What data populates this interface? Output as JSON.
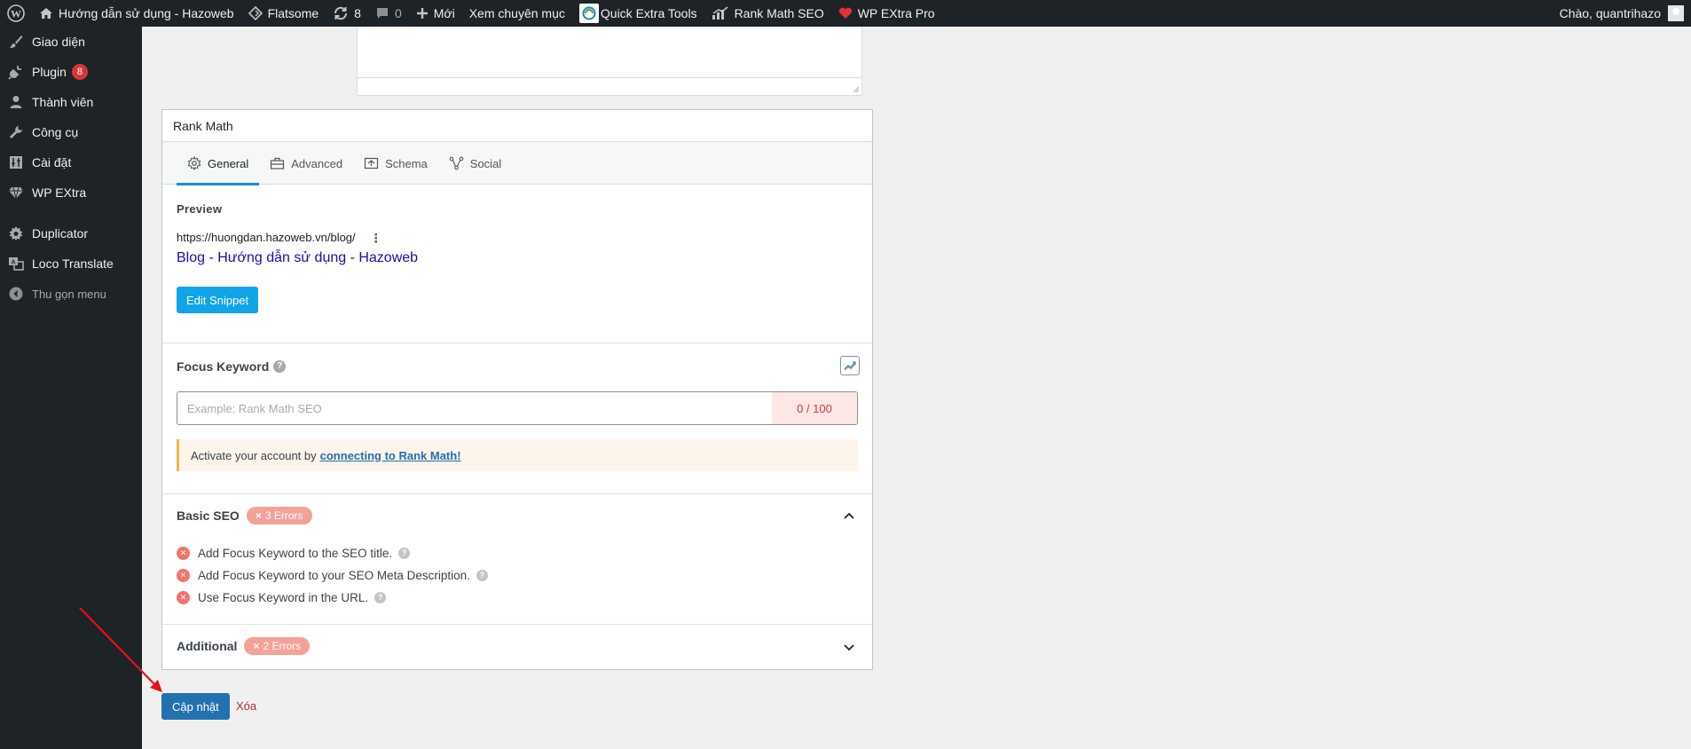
{
  "adminbar": {
    "site_name": "Hướng dẫn sử dụng - Hazoweb",
    "theme": "Flatsome",
    "updates_count": "8",
    "comments_count": "0",
    "new_label": "Mới",
    "view_category": "Xem chuyên mục",
    "quick_tools": "Quick Extra Tools",
    "rank_math": "Rank Math SEO",
    "wp_extra": "WP EXtra Pro",
    "greeting": "Chào, quantrihazo"
  },
  "sidebar": {
    "items": [
      {
        "label": "Giao diện",
        "icon": "brush-icon"
      },
      {
        "label": "Plugin",
        "icon": "plugin-icon",
        "badge": "8"
      },
      {
        "label": "Thành viên",
        "icon": "user-icon"
      },
      {
        "label": "Công cụ",
        "icon": "wrench-icon"
      },
      {
        "label": "Cài đặt",
        "icon": "settings-icon"
      },
      {
        "label": "WP EXtra",
        "icon": "diamond-icon"
      },
      {
        "label": "Duplicator",
        "icon": "duplicator-icon"
      },
      {
        "label": "Loco Translate",
        "icon": "translate-icon"
      }
    ],
    "collapse_label": "Thu gọn menu"
  },
  "rankmath": {
    "title": "Rank Math",
    "tabs": [
      "General",
      "Advanced",
      "Schema",
      "Social"
    ],
    "preview": {
      "heading": "Preview",
      "url": "https://huongdan.hazoweb.vn/blog/",
      "title": "Blog - Hướng dẫn sử dụng - Hazoweb",
      "edit_button": "Edit Snippet"
    },
    "focus": {
      "label": "Focus Keyword",
      "placeholder": "Example: Rank Math SEO",
      "count": "0 / 100",
      "notice_text": "Activate your account by",
      "notice_link": "connecting to Rank Math!"
    },
    "basic_seo": {
      "label": "Basic SEO",
      "badge": "3 Errors",
      "items": [
        "Add Focus Keyword to the SEO title.",
        "Add Focus Keyword to your SEO Meta Description.",
        "Use Focus Keyword in the URL."
      ]
    },
    "additional": {
      "label": "Additional",
      "badge": "2 Errors"
    }
  },
  "actions": {
    "update_button": "Cập nhật",
    "delete_link": "Xóa"
  },
  "colors": {
    "admin_dark": "#1d2327",
    "primary": "#2271b1",
    "snippet_button": "#10a5e8",
    "error_badge": "#f4a19a",
    "link": "#1a0dab",
    "annotation_arrow": "#e8101b"
  }
}
